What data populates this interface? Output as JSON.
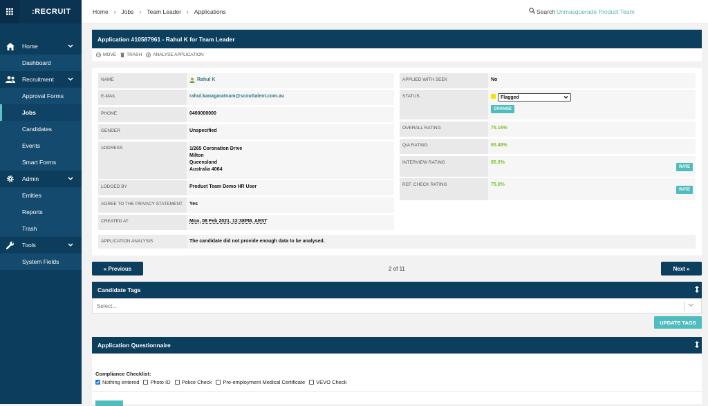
{
  "app": {
    "brand": ":RECRUIT"
  },
  "sidebar": {
    "sections": [
      {
        "label": "Home",
        "icon": "home-icon",
        "items": [
          {
            "label": "Dashboard",
            "active": false
          }
        ]
      },
      {
        "label": "Recruitment",
        "icon": "users-icon",
        "items": [
          {
            "label": "Approval Forms",
            "active": false
          },
          {
            "label": "Jobs",
            "active": true
          },
          {
            "label": "Candidates",
            "active": false
          },
          {
            "label": "Events",
            "active": false
          },
          {
            "label": "Smart Forms",
            "active": false
          }
        ]
      },
      {
        "label": "Admin",
        "icon": "gear-icon",
        "items": [
          {
            "label": "Entities",
            "active": false
          },
          {
            "label": "Reports",
            "active": false
          },
          {
            "label": "Trash",
            "active": false
          }
        ]
      },
      {
        "label": "Tools",
        "icon": "wrench-icon",
        "items": [
          {
            "label": "System Fields",
            "active": false
          }
        ]
      }
    ]
  },
  "breadcrumb": [
    "Home",
    "Jobs",
    "Team Leader",
    "Applications"
  ],
  "search": {
    "label": "Search",
    "user": "Unmasquerade Product Team"
  },
  "application": {
    "title": "Application #10587961 - Rahul K for Team Leader",
    "toolbar": {
      "move": "MOVE",
      "trash": "TRASH",
      "analyse": "ANALYSE APPLICATION"
    },
    "left": {
      "name_label": "NAME",
      "name": "Rahul K",
      "email_label": "E-MAIL",
      "email": "rahul.kanagaratnam@scouttalent.com.au",
      "phone_label": "PHONE",
      "phone": "0400000000",
      "gender_label": "GENDER",
      "gender": "Unspecified",
      "address_label": "ADDRESS",
      "address_line1": "1/265 Coronation Drive",
      "address_line2": "Milton",
      "address_line3": "Queensland",
      "address_line4": "Australia 4064",
      "logged_by_label": "LODGED BY",
      "logged_by": "Product Team Demo HR User",
      "privacy_label": "AGREE TO THE PRIVACY STATEMENT",
      "privacy": "Yes",
      "created_label": "CREATED AT",
      "created": "Mon, 08 Feb 2021, 12:38PM, AEST"
    },
    "right": {
      "seek_label": "APPLIED WITH SEEK",
      "seek": "No",
      "status_label": "STATUS",
      "status_value": "Flagged",
      "status_color": "#f5e400",
      "change_label": "CHANGE",
      "overall_label": "OVERALL RATING",
      "overall": "75.16%",
      "qa_label": "Q/A RATING",
      "qa": "65.48%",
      "interview_label": "INTERVIEW RATING",
      "interview": "85.0%",
      "ref_label": "REF. CHECK RATING",
      "ref": "75.0%",
      "rate_label": "RATE"
    },
    "analysis_label": "APPLICATION ANALYSIS",
    "analysis": "The candidate did not provide enough data to be analysed."
  },
  "pager": {
    "prev": "« Previous",
    "next": "Next »",
    "position": "2 of 11"
  },
  "tags": {
    "title": "Candidate Tags",
    "placeholder": "Select...",
    "update_label": "UPDATE TAGS"
  },
  "questionnaire": {
    "title": "Application Questionnaire",
    "checklist_title": "Compliance Checklist:",
    "options": [
      {
        "label": "Nothing entered",
        "checked": true
      },
      {
        "label": "Photo ID",
        "checked": false
      },
      {
        "label": "Police Check",
        "checked": false
      },
      {
        "label": "Pre-employment Medical Certificate",
        "checked": false
      },
      {
        "label": "VEVO Check",
        "checked": false
      }
    ]
  },
  "colors": {
    "navy": "#0c3e5e",
    "teal": "#4fbdbd",
    "rating_green": "#7cbf2b"
  }
}
